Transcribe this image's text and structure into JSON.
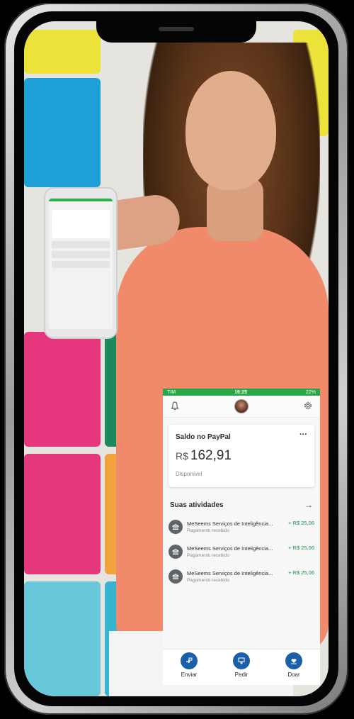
{
  "status_bar": {
    "carrier": "TIM",
    "time": "16:25",
    "battery": "22%"
  },
  "balance_card": {
    "title": "Saldo no PayPal",
    "currency": "R$",
    "amount": "162,91",
    "status": "Disponível",
    "menu": "···"
  },
  "activities": {
    "title": "Suas atividades",
    "items": [
      {
        "name": "MeSeems Serviços de Inteligência...",
        "status": "Pagamento recebido",
        "amount": "+ R$ 25,06"
      },
      {
        "name": "MeSeems Serviços de Inteligência...",
        "status": "Pagamento recebido",
        "amount": "+ R$ 25,06"
      },
      {
        "name": "MeSeems Serviços de Inteligência...",
        "status": "Pagamento recebido",
        "amount": "+ R$ 25,06"
      }
    ]
  },
  "tabs": [
    {
      "label": "Enviar",
      "icon": "send-icon"
    },
    {
      "label": "Pedir",
      "icon": "request-icon"
    },
    {
      "label": "Doar",
      "icon": "donate-icon"
    }
  ],
  "colors": {
    "status_green": "#27a844",
    "paypal_blue": "#1b5fa8",
    "amount_green": "#1e8a4c",
    "shirt": "#f08a6a"
  }
}
